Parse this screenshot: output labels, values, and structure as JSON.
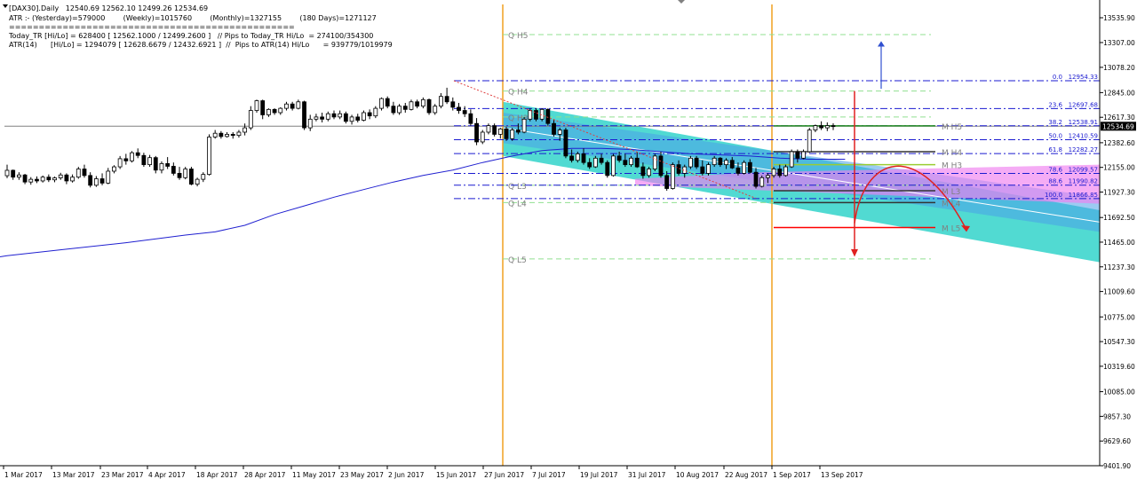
{
  "header": {
    "symbol_line": "[DAX30].Daily   12540.69 12562.10 12499.26 12534.69",
    "atr_line": "ATR :- (Yesterday)=579000        (Weekly)=1015760        (Monthly)=1327155        (180 Days)=1271127",
    "separator": "================================================",
    "today_line": "Today_TR [Hi/Lo] = 628400 [ 12562.1000 / 12499.2600 ]   // Pips to Today_TR Hi/Lo  = 274100/354300",
    "atr14_line": "ATR(14)      [Hi/Lo] = 1294079 [ 12628.6679 / 12432.6921 ]  //  Pips to ATR(14) Hi/Lo      = 939779/1019979"
  },
  "chart_data": {
    "type": "candlestick",
    "current_price": 12534.69,
    "current_price_label": "12534.69",
    "ylim": [
      9401.9,
      13535.9
    ],
    "y_ticks": [
      "13535.90",
      "13307.00",
      "13078.20",
      "12845.00",
      "12617.30",
      "12382.60",
      "12155.00",
      "11927.30",
      "11692.50",
      "11465.00",
      "11237.30",
      "11009.60",
      "10775.00",
      "10547.30",
      "10319.60",
      "10085.00",
      "9857.30",
      "9629.60",
      "9401.90"
    ],
    "x_ticks": [
      "1 Mar 2017",
      "13 Mar 2017",
      "23 Mar 2017",
      "4 Apr 2017",
      "18 Apr 2017",
      "28 Apr 2017",
      "11 May 2017",
      "23 May 2017",
      "2 Jun 2017",
      "15 Jun 2017",
      "27 Jun 2017",
      "7 Jul 2017",
      "19 Jul 2017",
      "31 Jul 2017",
      "10 Aug 2017",
      "22 Aug 2017",
      "1 Sep 2017",
      "13 Sep 2017"
    ],
    "candles": [
      [
        12078,
        12180,
        12055,
        12128
      ],
      [
        12128,
        12135,
        12040,
        12065
      ],
      [
        12065,
        12110,
        12040,
        12085
      ],
      [
        12085,
        12095,
        12000,
        12020
      ],
      [
        12020,
        12065,
        11995,
        12045
      ],
      [
        12045,
        12072,
        12010,
        12030
      ],
      [
        12030,
        12080,
        12015,
        12065
      ],
      [
        12065,
        12090,
        12020,
        12040
      ],
      [
        12040,
        12070,
        12018,
        12058
      ],
      [
        12058,
        12105,
        12040,
        12085
      ],
      [
        12085,
        12100,
        12000,
        12030
      ],
      [
        12030,
        12090,
        12015,
        12065
      ],
      [
        12065,
        12160,
        12050,
        12140
      ],
      [
        12140,
        12180,
        12060,
        12080
      ],
      [
        12080,
        12110,
        11970,
        11990
      ],
      [
        11990,
        12075,
        11975,
        12050
      ],
      [
        12050,
        12100,
        11990,
        12010
      ],
      [
        12010,
        12150,
        12000,
        12120
      ],
      [
        12120,
        12175,
        12100,
        12160
      ],
      [
        12160,
        12260,
        12140,
        12235
      ],
      [
        12235,
        12280,
        12180,
        12215
      ],
      [
        12215,
        12305,
        12200,
        12290
      ],
      [
        12290,
        12330,
        12240,
        12265
      ],
      [
        12265,
        12290,
        12160,
        12180
      ],
      [
        12180,
        12270,
        12160,
        12245
      ],
      [
        12245,
        12260,
        12100,
        12130
      ],
      [
        12130,
        12210,
        12100,
        12190
      ],
      [
        12190,
        12250,
        12140,
        12165
      ],
      [
        12165,
        12200,
        12080,
        12100
      ],
      [
        12100,
        12160,
        12040,
        12060
      ],
      [
        12060,
        12160,
        12045,
        12140
      ],
      [
        12140,
        12160,
        11990,
        12000
      ],
      [
        12000,
        12060,
        11980,
        12045
      ],
      [
        12045,
        12110,
        12020,
        12090
      ],
      [
        12090,
        12460,
        12080,
        12435
      ],
      [
        12435,
        12500,
        12420,
        12470
      ],
      [
        12470,
        12490,
        12420,
        12440
      ],
      [
        12440,
        12480,
        12430,
        12460
      ],
      [
        12460,
        12480,
        12420,
        12450
      ],
      [
        12450,
        12500,
        12430,
        12480
      ],
      [
        12480,
        12560,
        12450,
        12520
      ],
      [
        12520,
        12720,
        12500,
        12680
      ],
      [
        12680,
        12780,
        12660,
        12770
      ],
      [
        12770,
        12780,
        12600,
        12640
      ],
      [
        12640,
        12700,
        12620,
        12690
      ],
      [
        12690,
        12700,
        12640,
        12660
      ],
      [
        12660,
        12710,
        12640,
        12700
      ],
      [
        12700,
        12760,
        12680,
        12740
      ],
      [
        12740,
        12760,
        12680,
        12700
      ],
      [
        12700,
        12780,
        12690,
        12760
      ],
      [
        12760,
        12770,
        12500,
        12520
      ],
      [
        12520,
        12640,
        12490,
        12600
      ],
      [
        12600,
        12650,
        12580,
        12620
      ],
      [
        12620,
        12660,
        12570,
        12600
      ],
      [
        12600,
        12670,
        12580,
        12650
      ],
      [
        12650,
        12680,
        12600,
        12620
      ],
      [
        12620,
        12680,
        12600,
        12650
      ],
      [
        12650,
        12670,
        12560,
        12580
      ],
      [
        12580,
        12640,
        12550,
        12620
      ],
      [
        12620,
        12650,
        12570,
        12590
      ],
      [
        12590,
        12680,
        12580,
        12660
      ],
      [
        12660,
        12690,
        12600,
        12630
      ],
      [
        12630,
        12720,
        12610,
        12700
      ],
      [
        12700,
        12800,
        12680,
        12790
      ],
      [
        12790,
        12810,
        12700,
        12720
      ],
      [
        12720,
        12760,
        12640,
        12660
      ],
      [
        12660,
        12740,
        12640,
        12720
      ],
      [
        12720,
        12750,
        12660,
        12690
      ],
      [
        12690,
        12780,
        12680,
        12760
      ],
      [
        12760,
        12780,
        12700,
        12720
      ],
      [
        12720,
        12800,
        12700,
        12780
      ],
      [
        12780,
        12790,
        12640,
        12660
      ],
      [
        12660,
        12740,
        12640,
        12720
      ],
      [
        12720,
        12840,
        12700,
        12810
      ],
      [
        12810,
        12890,
        12740,
        12760
      ],
      [
        12760,
        12800,
        12680,
        12710
      ],
      [
        12710,
        12750,
        12650,
        12680
      ],
      [
        12680,
        12720,
        12620,
        12650
      ],
      [
        12650,
        12690,
        12540,
        12560
      ],
      [
        12560,
        12610,
        12360,
        12390
      ],
      [
        12390,
        12500,
        12370,
        12480
      ],
      [
        12480,
        12560,
        12460,
        12540
      ],
      [
        12540,
        12560,
        12440,
        12460
      ],
      [
        12460,
        12520,
        12420,
        12510
      ],
      [
        12510,
        12530,
        12400,
        12420
      ],
      [
        12420,
        12520,
        12400,
        12500
      ],
      [
        12500,
        12560,
        12460,
        12480
      ],
      [
        12480,
        12620,
        12470,
        12600
      ],
      [
        12600,
        12700,
        12580,
        12680
      ],
      [
        12680,
        12700,
        12580,
        12600
      ],
      [
        12600,
        12700,
        12580,
        12690
      ],
      [
        12690,
        12700,
        12540,
        12560
      ],
      [
        12560,
        12600,
        12440,
        12460
      ],
      [
        12460,
        12520,
        12400,
        12500
      ],
      [
        12500,
        12520,
        12240,
        12260
      ],
      [
        12260,
        12320,
        12200,
        12220
      ],
      [
        12220,
        12300,
        12200,
        12280
      ],
      [
        12280,
        12330,
        12180,
        12200
      ],
      [
        12200,
        12240,
        12140,
        12160
      ],
      [
        12160,
        12260,
        12150,
        12240
      ],
      [
        12240,
        12280,
        12180,
        12200
      ],
      [
        12200,
        12220,
        12060,
        12080
      ],
      [
        12080,
        12280,
        12070,
        12260
      ],
      [
        12260,
        12300,
        12200,
        12220
      ],
      [
        12220,
        12280,
        12160,
        12180
      ],
      [
        12180,
        12260,
        12160,
        12240
      ],
      [
        12240,
        12300,
        12150,
        12160
      ],
      [
        12160,
        12200,
        12050,
        12080
      ],
      [
        12080,
        12160,
        12060,
        12140
      ],
      [
        12140,
        12280,
        12120,
        12260
      ],
      [
        12260,
        12300,
        12060,
        12080
      ],
      [
        12080,
        12120,
        11940,
        11960
      ],
      [
        11960,
        12200,
        11950,
        12180
      ],
      [
        12180,
        12220,
        12080,
        12100
      ],
      [
        12100,
        12180,
        12060,
        12160
      ],
      [
        12160,
        12260,
        12140,
        12240
      ],
      [
        12240,
        12260,
        12140,
        12160
      ],
      [
        12160,
        12220,
        12080,
        12100
      ],
      [
        12100,
        12200,
        12080,
        12180
      ],
      [
        12180,
        12260,
        12160,
        12240
      ],
      [
        12240,
        12250,
        12160,
        12180
      ],
      [
        12180,
        12240,
        12140,
        12220
      ],
      [
        12220,
        12250,
        12140,
        12150
      ],
      [
        12150,
        12200,
        12080,
        12100
      ],
      [
        12100,
        12220,
        12090,
        12200
      ],
      [
        12200,
        12230,
        12100,
        12110
      ],
      [
        12110,
        12150,
        11960,
        11980
      ],
      [
        11980,
        12080,
        11970,
        12060
      ],
      [
        12060,
        12100,
        12010,
        12080
      ],
      [
        12080,
        12160,
        12060,
        12140
      ],
      [
        12140,
        12180,
        12060,
        12080
      ],
      [
        12080,
        12180,
        12070,
        12160
      ],
      [
        12160,
        12320,
        12150,
        12300
      ],
      [
        12300,
        12320,
        12200,
        12240
      ],
      [
        12240,
        12320,
        12230,
        12300
      ],
      [
        12300,
        12520,
        12290,
        12500
      ],
      [
        12500,
        12550,
        12480,
        12540
      ],
      [
        12540,
        12580,
        12500,
        12520
      ],
      [
        12520,
        12570,
        12490,
        12540
      ],
      [
        12540,
        12562,
        12499,
        12534
      ]
    ],
    "moving_average": [
      [
        0,
        11340
      ],
      [
        10,
        11400
      ],
      [
        20,
        11460
      ],
      [
        30,
        11530
      ],
      [
        35,
        11560
      ],
      [
        40,
        11620
      ],
      [
        45,
        11720
      ],
      [
        50,
        11800
      ],
      [
        55,
        11880
      ],
      [
        60,
        11950
      ],
      [
        65,
        12020
      ],
      [
        70,
        12080
      ],
      [
        75,
        12130
      ],
      [
        80,
        12200
      ],
      [
        85,
        12260
      ],
      [
        90,
        12310
      ],
      [
        95,
        12330
      ],
      [
        100,
        12330
      ],
      [
        105,
        12320
      ],
      [
        110,
        12300
      ],
      [
        115,
        12280
      ],
      [
        120,
        12270
      ],
      [
        125,
        12260
      ],
      [
        130,
        12240
      ],
      [
        135,
        12230
      ],
      [
        141,
        12230
      ]
    ],
    "fib_levels": [
      {
        "pct": "0.0",
        "price": "12954.33",
        "value": 12954.33
      },
      {
        "pct": "23.6",
        "price": "12697.68",
        "value": 12697.68
      },
      {
        "pct": "38.2",
        "price": "12538.91",
        "value": 12538.91
      },
      {
        "pct": "50.0",
        "price": "12410.59",
        "value": 12410.59
      },
      {
        "pct": "61.8",
        "price": "12282.27",
        "value": 12282.27
      },
      {
        "pct": "78.6",
        "price": "12099.57",
        "value": 12099.57
      },
      {
        "pct": "88.6",
        "price": "11990.82",
        "value": 11990.82
      },
      {
        "pct": "100.0",
        "price": "11866.85",
        "value": 11866.85
      }
    ],
    "q_levels": [
      {
        "label": "Q  H5",
        "value": 13380
      },
      {
        "label": "Q  H4",
        "value": 12860
      },
      {
        "label": "Q  H3",
        "value": 12620
      },
      {
        "label": "Q  L3",
        "value": 11990
      },
      {
        "label": "Q  L4",
        "value": 11830
      },
      {
        "label": "Q  L5",
        "value": 11310
      }
    ],
    "m_levels": [
      {
        "label": "M  H5",
        "value": 12538,
        "color": "#228b22"
      },
      {
        "label": "M  H4",
        "value": 12300,
        "color": "#333333"
      },
      {
        "label": "M  H3",
        "value": 12180,
        "color": "#9acd32"
      },
      {
        "label": "M  L3",
        "value": 11940,
        "color": "#333333"
      },
      {
        "label": "M  L4",
        "value": 11830,
        "color": "#333333"
      },
      {
        "label": "M  L5",
        "value": 11600,
        "color": "#ff0000"
      }
    ],
    "colors": {
      "candle": "#000000",
      "moving_average": "#2020d0",
      "fib": "#1a1ad0",
      "q_levels": "#90e090",
      "vertical_markers": "#f0a020",
      "channel_cyan": "#48d8d0",
      "channel_blue": "#4aa0e8",
      "channel_magenta": "#f080f0",
      "up_arrow": "#3050d0",
      "down_arrow": "#e02020",
      "price_line": "#808080"
    }
  }
}
